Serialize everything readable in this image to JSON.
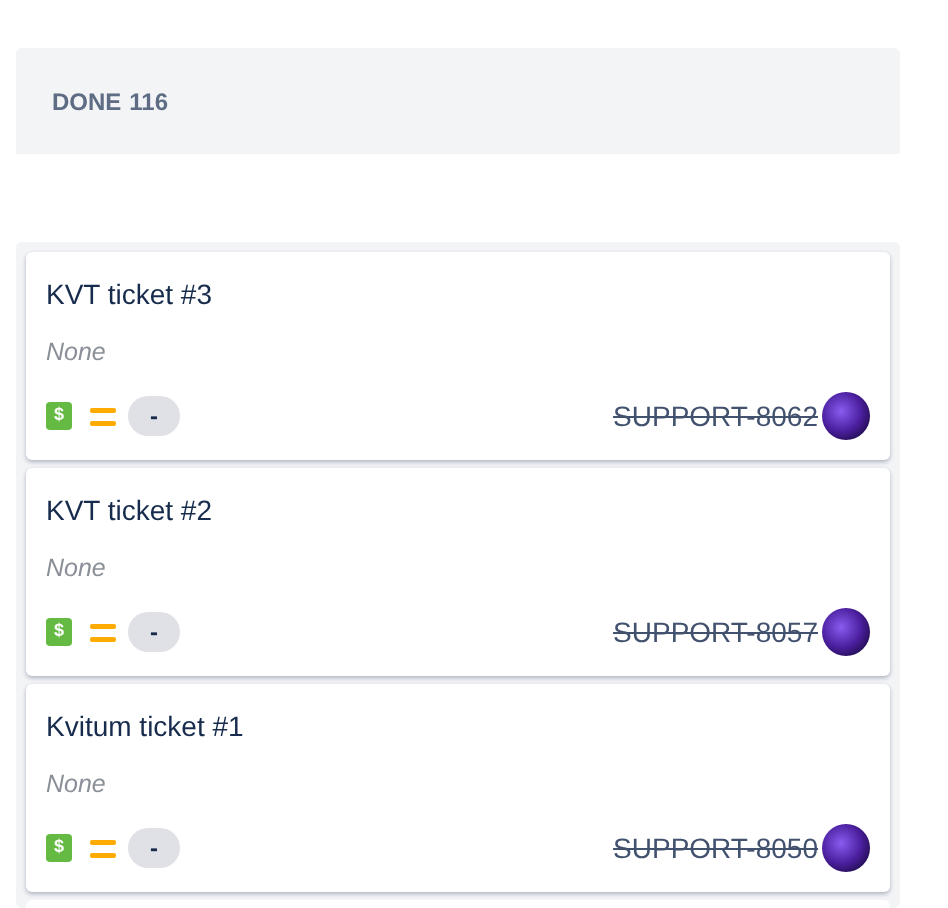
{
  "column": {
    "title": "DONE",
    "count": "116"
  },
  "cards": [
    {
      "title": "KVT ticket #3",
      "description": "None",
      "type_symbol": "$",
      "kind": "medium",
      "estimate": "-",
      "key": "SUPPORT-8062",
      "resolved": true
    },
    {
      "title": "KVT ticket #2",
      "description": "None",
      "type_symbol": "$",
      "kind": "medium",
      "estimate": "-",
      "key": "SUPPORT-8057",
      "resolved": true
    },
    {
      "title": "Kvitum ticket #1",
      "description": "None",
      "type_symbol": "$",
      "kind": "medium",
      "estimate": "-",
      "key": "SUPPORT-8050",
      "resolved": true
    }
  ]
}
